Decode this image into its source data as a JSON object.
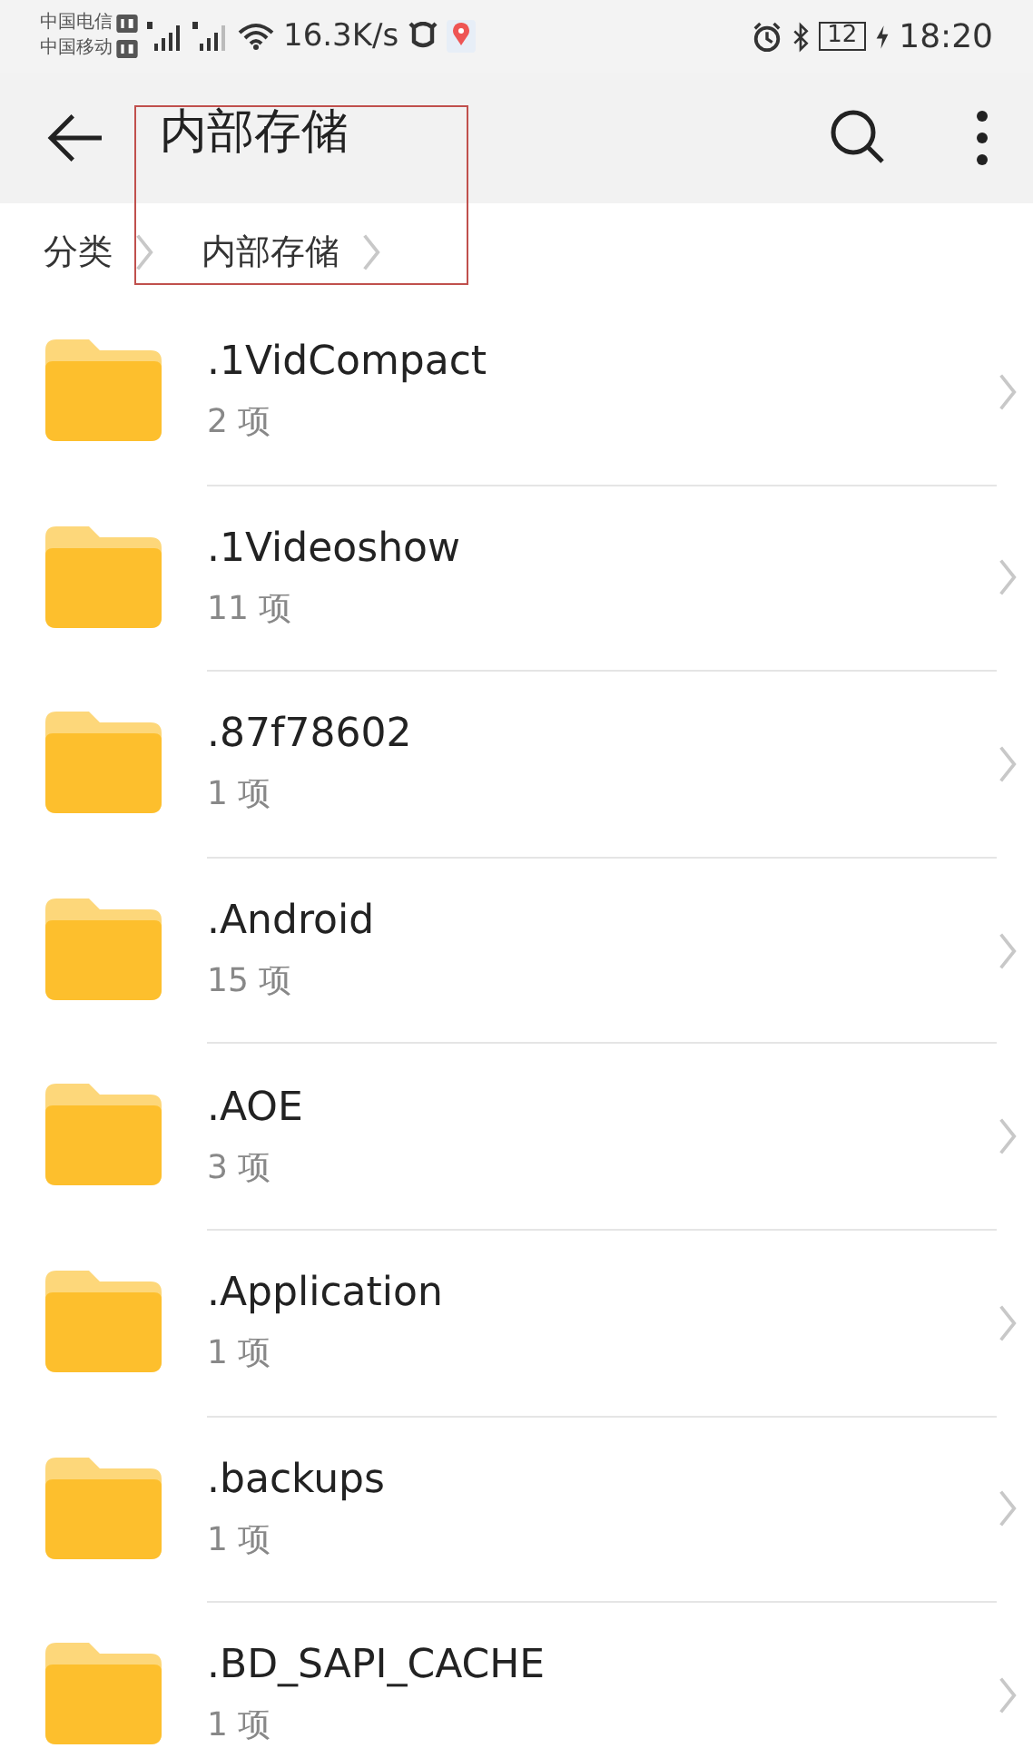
{
  "status_bar": {
    "carriers": [
      "中国电信",
      "中国移动"
    ],
    "speed": "16.3K/s",
    "battery": "12",
    "time": "18:20"
  },
  "toolbar": {
    "title": "内部存储"
  },
  "breadcrumb": [
    "分类",
    "内部存储"
  ],
  "annotation_box": {
    "shown": true
  },
  "folders": [
    {
      "name": ".1VidCompact",
      "count": "2 项"
    },
    {
      "name": ".1Videoshow",
      "count": "11 项"
    },
    {
      "name": ".87f78602",
      "count": "1 项"
    },
    {
      "name": ".Android",
      "count": "15 项"
    },
    {
      "name": ".AOE",
      "count": "3 项"
    },
    {
      "name": ".Application",
      "count": "1 项"
    },
    {
      "name": ".backups",
      "count": "1 项"
    },
    {
      "name": ".BD_SAPI_CACHE",
      "count": "1 项"
    }
  ]
}
